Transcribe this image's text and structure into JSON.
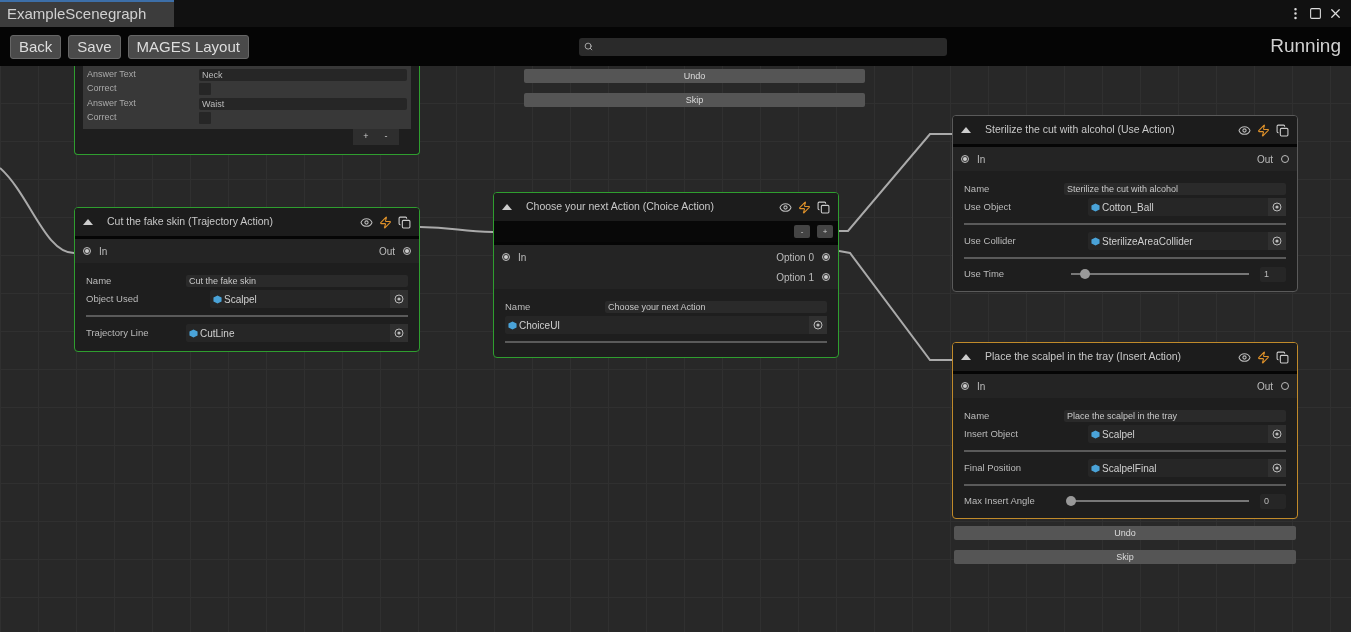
{
  "window": {
    "tab_title": "ExampleScenegraph"
  },
  "toolbar": {
    "buttons": [
      "Back",
      "Save",
      "MAGES Layout"
    ],
    "status": "Running"
  },
  "canvas": {
    "floating_buttons": [
      "Undo",
      "Skip"
    ],
    "nodes": [
      {
        "color": "#2f9e2f",
        "answers": [
          {
            "label": "Answer Text",
            "value": "Neck",
            "check_label": "Correct",
            "correct": false
          },
          {
            "label": "Answer Text",
            "value": "Waist",
            "check_label": "Correct",
            "correct": false
          }
        ],
        "list_buttons": [
          "+",
          "-"
        ]
      },
      {
        "title": "Cut the fake skin (Trajectory Action)",
        "color": "#2f9e2f",
        "inputs": [
          {
            "label": "In",
            "connected": true
          }
        ],
        "outputs": [
          {
            "label": "Out",
            "connected": true
          }
        ],
        "fields": [
          {
            "kind": "text",
            "label": "Name",
            "value": "Cut the fake skin"
          },
          {
            "kind": "object",
            "label": "Object Used",
            "value": "Scalpel"
          },
          {
            "kind": "divider"
          },
          {
            "kind": "object_wide",
            "label": "Trajectory Line",
            "value": "CutLine"
          }
        ]
      },
      {
        "title": "Choose your next Action (Choice Action)",
        "color": "#2f9e2f",
        "choice_buttons": [
          "-",
          "+"
        ],
        "inputs": [
          {
            "label": "In",
            "connected": true
          }
        ],
        "outputs": [
          {
            "label": "Option 0",
            "connected": true
          },
          {
            "label": "Option 1",
            "connected": true
          }
        ],
        "fields": [
          {
            "kind": "text",
            "label": "Name",
            "value": "Choose your next Action"
          },
          {
            "kind": "object_full",
            "value": "ChoiceUI"
          },
          {
            "kind": "divider"
          }
        ]
      },
      {
        "title": "Sterilize the cut with alcohol (Use Action)",
        "color": "#5a5a5a",
        "inputs": [
          {
            "label": "In",
            "connected": true
          }
        ],
        "outputs": [
          {
            "label": "Out",
            "connected": false
          }
        ],
        "fields": [
          {
            "kind": "text",
            "label": "Name",
            "value": "Sterilize the cut with alcohol"
          },
          {
            "kind": "object",
            "label": "Use Object",
            "value": "Cotton_Ball"
          },
          {
            "kind": "divider"
          },
          {
            "kind": "object",
            "label": "Use Collider",
            "value": "SterilizeAreaCollider"
          },
          {
            "kind": "divider"
          },
          {
            "kind": "slider",
            "label": "Use Time",
            "level": 0.08,
            "value": "1"
          }
        ]
      },
      {
        "title": "Place the scalpel in the tray (Insert Action)",
        "color": "#c08a2a",
        "inputs": [
          {
            "label": "In",
            "connected": true
          }
        ],
        "outputs": [
          {
            "label": "Out",
            "connected": false
          }
        ],
        "fields": [
          {
            "kind": "text",
            "label": "Name",
            "value": "Place the scalpel in the tray"
          },
          {
            "kind": "object",
            "label": "Insert Object",
            "value": "Scalpel"
          },
          {
            "kind": "divider"
          },
          {
            "kind": "object",
            "label": "Final Position",
            "value": "ScalpelFinal"
          },
          {
            "kind": "divider"
          },
          {
            "kind": "slider",
            "label": "Max Insert Angle",
            "level": 0,
            "value": "0"
          }
        ],
        "buttons": [
          "Undo",
          "Skip"
        ]
      }
    ]
  }
}
